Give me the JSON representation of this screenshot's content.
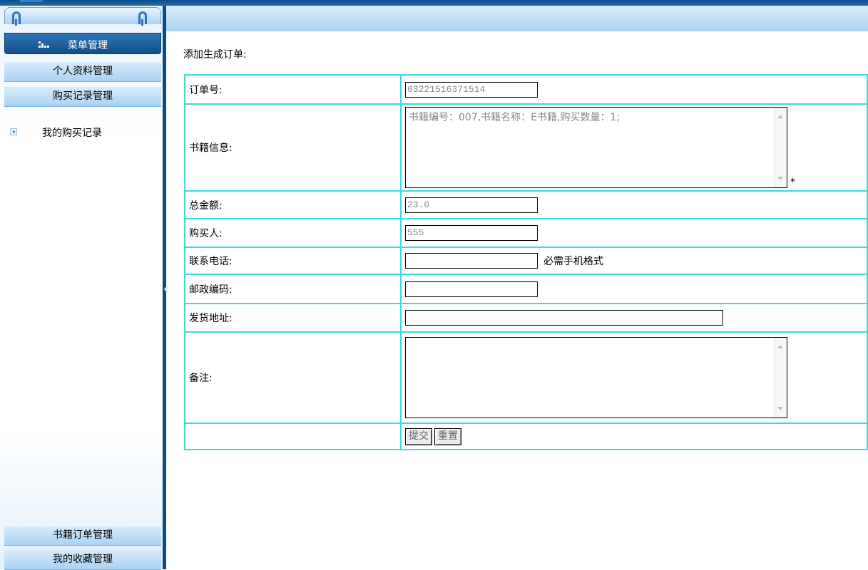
{
  "sidebar": {
    "menu_title": "菜单管理",
    "sections": [
      {
        "label": "个人资料管理"
      },
      {
        "label": "购买记录管理"
      },
      {
        "label": "书籍订单管理"
      },
      {
        "label": "我的收藏管理"
      }
    ],
    "sub_items": [
      {
        "label": "我的购买记录",
        "icon": "arrow-right-icon"
      }
    ]
  },
  "main": {
    "page_title": "添加生成订单:",
    "form": {
      "order_no": {
        "label": "订单号:",
        "value": "03221516371514"
      },
      "book_info": {
        "label": "书籍信息:",
        "value": "书籍编号：007,书籍名称：E书籍,购买数量：1;",
        "required_mark": "*"
      },
      "total": {
        "label": "总金额:",
        "value": "23.0"
      },
      "buyer": {
        "label": "购买人:",
        "value": "555"
      },
      "phone": {
        "label": "联系电话:",
        "value": "",
        "hint": "必需手机格式"
      },
      "postcode": {
        "label": "邮政编码:",
        "value": ""
      },
      "address": {
        "label": "发货地址:",
        "value": ""
      },
      "remark": {
        "label": "备注:",
        "value": ""
      },
      "submit_label": "提交",
      "reset_label": "重置"
    }
  },
  "colors": {
    "table_border": "#3ed8de",
    "sidebar_dark": "#124f8c",
    "sidebar_light": "#a9d2f3"
  }
}
